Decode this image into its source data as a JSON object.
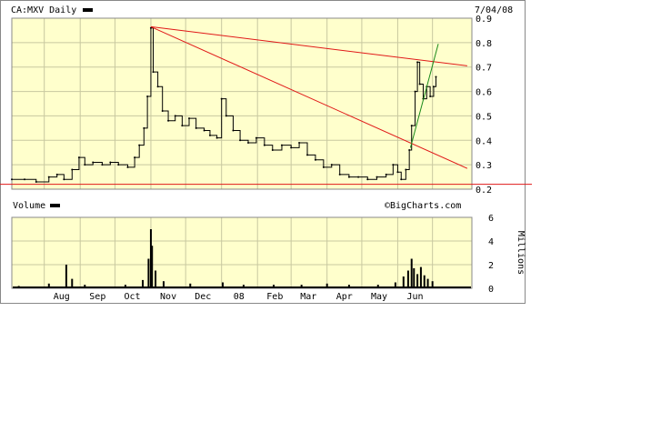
{
  "chart_data": [
    {
      "type": "line",
      "title": "CA:MXV Daily",
      "date_label": "7/04/08",
      "x_tick_labels": [
        "Aug",
        "Sep",
        "Oct",
        "Nov",
        "Dec",
        "08",
        "Feb",
        "Mar",
        "Apr",
        "May",
        "Jun"
      ],
      "y_tick_labels": [
        "0.9",
        "0.8",
        "0.7",
        "0.6",
        "0.5",
        "0.4",
        "0.3",
        "0.2"
      ],
      "ylim": [
        0.2,
        0.9
      ],
      "grid": true,
      "series": [
        {
          "name": "CA:MXV",
          "points": [
            [
              "2007-07-04",
              0.24
            ],
            [
              "2007-07-15",
              0.24
            ],
            [
              "2007-07-25",
              0.23
            ],
            [
              "2007-08-05",
              0.25
            ],
            [
              "2007-08-12",
              0.26
            ],
            [
              "2007-08-18",
              0.24
            ],
            [
              "2007-08-25",
              0.28
            ],
            [
              "2007-08-31",
              0.33
            ],
            [
              "2007-09-05",
              0.3
            ],
            [
              "2007-09-12",
              0.31
            ],
            [
              "2007-09-20",
              0.3
            ],
            [
              "2007-09-27",
              0.31
            ],
            [
              "2007-10-04",
              0.3
            ],
            [
              "2007-10-12",
              0.29
            ],
            [
              "2007-10-18",
              0.33
            ],
            [
              "2007-10-22",
              0.38
            ],
            [
              "2007-10-26",
              0.45
            ],
            [
              "2007-10-29",
              0.58
            ],
            [
              "2007-11-01",
              0.86
            ],
            [
              "2007-11-03",
              0.68
            ],
            [
              "2007-11-07",
              0.62
            ],
            [
              "2007-11-11",
              0.52
            ],
            [
              "2007-11-16",
              0.48
            ],
            [
              "2007-11-22",
              0.5
            ],
            [
              "2007-11-28",
              0.46
            ],
            [
              "2007-12-04",
              0.49
            ],
            [
              "2007-12-10",
              0.45
            ],
            [
              "2007-12-17",
              0.44
            ],
            [
              "2007-12-22",
              0.42
            ],
            [
              "2007-12-28",
              0.41
            ],
            [
              "2008-01-01",
              0.57
            ],
            [
              "2008-01-05",
              0.5
            ],
            [
              "2008-01-11",
              0.44
            ],
            [
              "2008-01-17",
              0.4
            ],
            [
              "2008-01-24",
              0.39
            ],
            [
              "2008-01-31",
              0.41
            ],
            [
              "2008-02-07",
              0.38
            ],
            [
              "2008-02-14",
              0.36
            ],
            [
              "2008-02-22",
              0.38
            ],
            [
              "2008-03-01",
              0.37
            ],
            [
              "2008-03-08",
              0.39
            ],
            [
              "2008-03-15",
              0.34
            ],
            [
              "2008-03-22",
              0.32
            ],
            [
              "2008-03-29",
              0.29
            ],
            [
              "2008-04-05",
              0.3
            ],
            [
              "2008-04-12",
              0.26
            ],
            [
              "2008-04-20",
              0.25
            ],
            [
              "2008-04-28",
              0.25
            ],
            [
              "2008-05-06",
              0.24
            ],
            [
              "2008-05-14",
              0.25
            ],
            [
              "2008-05-22",
              0.26
            ],
            [
              "2008-05-28",
              0.3
            ],
            [
              "2008-06-01",
              0.27
            ],
            [
              "2008-06-04",
              0.24
            ],
            [
              "2008-06-08",
              0.28
            ],
            [
              "2008-06-11",
              0.36
            ],
            [
              "2008-06-13",
              0.46
            ],
            [
              "2008-06-16",
              0.6
            ],
            [
              "2008-06-18",
              0.72
            ],
            [
              "2008-06-20",
              0.63
            ],
            [
              "2008-06-23",
              0.57
            ],
            [
              "2008-06-26",
              0.62
            ],
            [
              "2008-06-29",
              0.58
            ],
            [
              "2008-07-02",
              0.62
            ],
            [
              "2008-07-04",
              0.66
            ]
          ]
        }
      ],
      "annotations": [
        {
          "kind": "trendline",
          "color": "#e01818",
          "from": [
            "2007-11-01",
            0.865
          ],
          "to": [
            "2008-07-31",
            0.705
          ]
        },
        {
          "kind": "trendline",
          "color": "#e01818",
          "from": [
            "2007-11-01",
            0.865
          ],
          "to": [
            "2008-07-31",
            0.285
          ]
        },
        {
          "kind": "trendline",
          "color": "#1a8a1a",
          "from": [
            "2008-06-12",
            0.37
          ],
          "to": [
            "2008-07-06",
            0.795
          ]
        },
        {
          "kind": "hline",
          "color": "#e01818",
          "y": 0.22
        }
      ]
    },
    {
      "type": "bar",
      "title": "Volume",
      "watermark": "©BigCharts.com",
      "ylabel": "Millions",
      "y_tick_labels": [
        "6",
        "4",
        "2",
        "0"
      ],
      "ylim": [
        0,
        6
      ],
      "spikes": [
        [
          "2007-07-10",
          0.2
        ],
        [
          "2007-08-05",
          0.4
        ],
        [
          "2007-08-20",
          2.0
        ],
        [
          "2007-08-25",
          0.8
        ],
        [
          "2007-09-05",
          0.3
        ],
        [
          "2007-10-10",
          0.3
        ],
        [
          "2007-10-25",
          0.7
        ],
        [
          "2007-10-30",
          2.5
        ],
        [
          "2007-11-01",
          5.0
        ],
        [
          "2007-11-02",
          3.6
        ],
        [
          "2007-11-05",
          1.5
        ],
        [
          "2007-11-12",
          0.6
        ],
        [
          "2007-12-05",
          0.4
        ],
        [
          "2008-01-02",
          0.5
        ],
        [
          "2008-01-20",
          0.3
        ],
        [
          "2008-02-15",
          0.3
        ],
        [
          "2008-03-10",
          0.3
        ],
        [
          "2008-04-01",
          0.4
        ],
        [
          "2008-04-20",
          0.3
        ],
        [
          "2008-05-15",
          0.3
        ],
        [
          "2008-05-30",
          0.5
        ],
        [
          "2008-06-06",
          1.0
        ],
        [
          "2008-06-10",
          1.5
        ],
        [
          "2008-06-13",
          2.5
        ],
        [
          "2008-06-15",
          1.7
        ],
        [
          "2008-06-18",
          1.2
        ],
        [
          "2008-06-21",
          1.8
        ],
        [
          "2008-06-24",
          1.1
        ],
        [
          "2008-06-27",
          0.8
        ],
        [
          "2008-07-01",
          0.6
        ]
      ]
    }
  ]
}
